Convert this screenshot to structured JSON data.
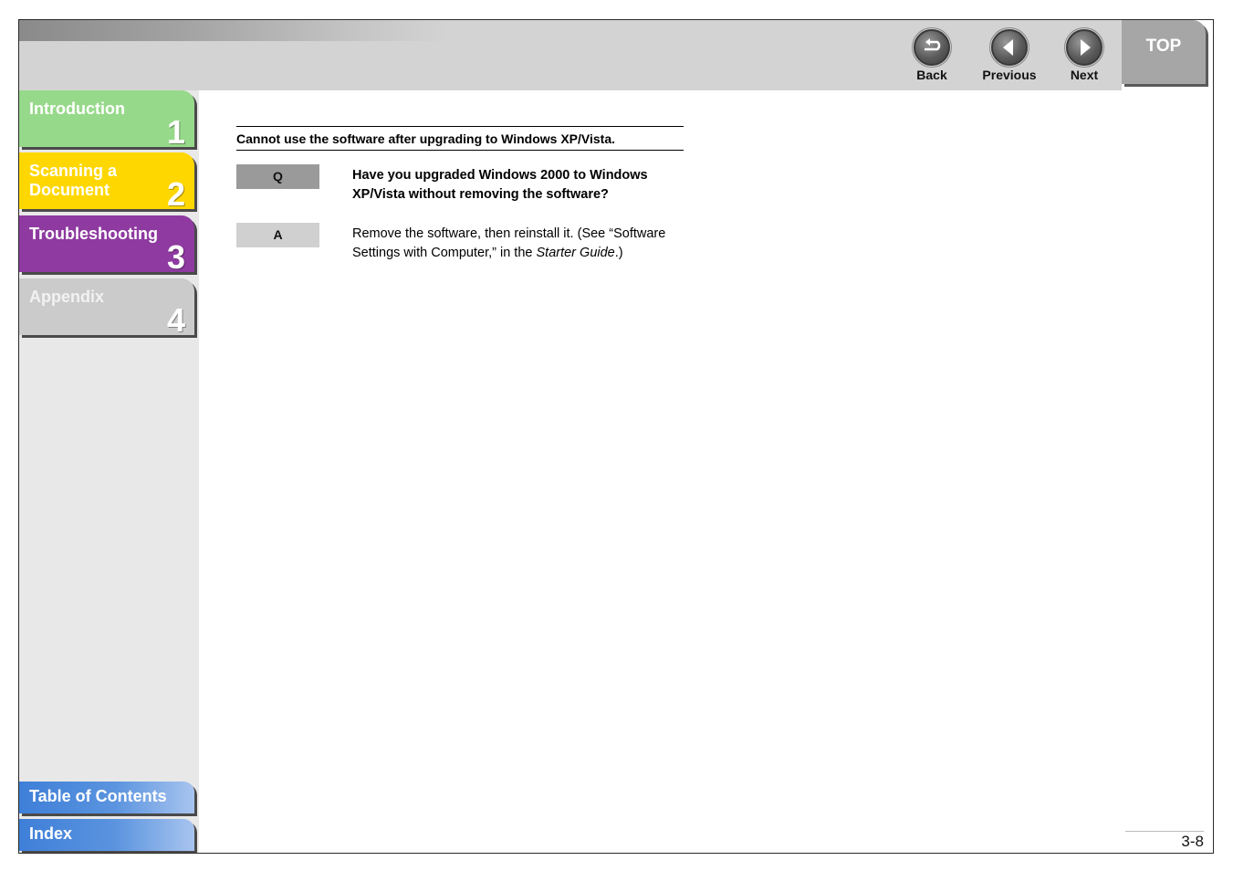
{
  "nav": {
    "back_label": "Back",
    "previous_label": "Previous",
    "next_label": "Next",
    "top_label": "TOP"
  },
  "sidebar": {
    "chapters": [
      {
        "label": "Introduction",
        "number": "1"
      },
      {
        "label": "Scanning a Document",
        "number": "2"
      },
      {
        "label": "Troubleshooting",
        "number": "3"
      },
      {
        "label": "Appendix",
        "number": "4"
      }
    ],
    "toc_label": "Table of Contents",
    "index_label": "Index"
  },
  "content": {
    "section_title": "Cannot use the software after upgrading to Windows XP/Vista.",
    "question_marker": "Q",
    "question_text": "Have you upgraded Windows 2000 to Windows XP/Vista without removing the software?",
    "answer_marker": "A",
    "answer_text_pre": "Remove the software, then reinstall it. (See “Software Settings with Computer,” in the ",
    "answer_text_italic": "Starter Guide",
    "answer_text_post": ".)"
  },
  "footer": {
    "page_number": "3-8"
  },
  "colors": {
    "intro": "#97d98a",
    "scanning": "#ffd700",
    "troubleshooting": "#8e3aa0",
    "appendix": "#cbcbcb",
    "link_blue": "#3e7fd8"
  }
}
